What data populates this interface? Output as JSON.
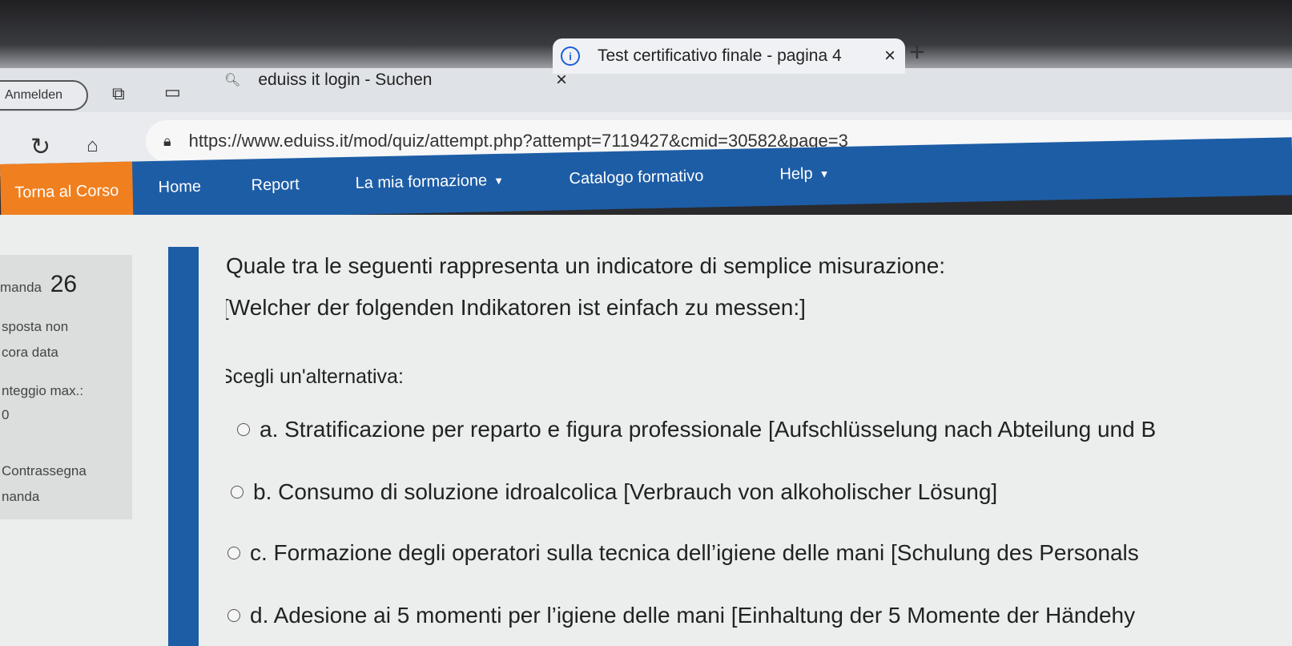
{
  "browser": {
    "profile_button": "Anmelden",
    "tabs": [
      {
        "label": "eduiss it login - Suchen",
        "close": "×"
      },
      {
        "label": "Test certificativo finale - pagina 4",
        "close": "×"
      }
    ],
    "new_tab": "+",
    "url": "https://www.eduiss.it/mod/quiz/attempt.php?attempt=7119427&cmid=30582&page=3"
  },
  "nav": {
    "back_to_course": "Torna al Corso",
    "items": [
      {
        "label": "Home"
      },
      {
        "label": "Report"
      },
      {
        "label": "La mia formazione"
      },
      {
        "label": "Catalogo formativo"
      },
      {
        "label": "Help"
      }
    ]
  },
  "question_info": {
    "number_label": "manda",
    "number": "26",
    "status_line1": "sposta non",
    "status_line2": "cora data",
    "score_label": "nteggio max.:",
    "score_value": "0",
    "flag_line1": "Contrassegna",
    "flag_line2": "nanda"
  },
  "question": {
    "text_it": "Quale tra le seguenti rappresenta un indicatore di semplice misurazione:",
    "text_de": "[Welcher der folgenden Indikatoren ist einfach zu messen:]",
    "prompt": "Scegli un'alternativa:",
    "options": [
      {
        "label": "a. Stratificazione per reparto e figura professionale [Aufschlüsselung nach Abteilung und B"
      },
      {
        "label": "b. Consumo di soluzione idroalcolica [Verbrauch von alkoholischer Lösung]"
      },
      {
        "label": "c. Formazione degli operatori sulla tecnica dell’igiene delle mani [Schulung des Personals"
      },
      {
        "label": "d. Adesione ai 5 momenti per l’igiene delle mani [Einhaltung der 5 Momente der Händehy"
      }
    ]
  }
}
